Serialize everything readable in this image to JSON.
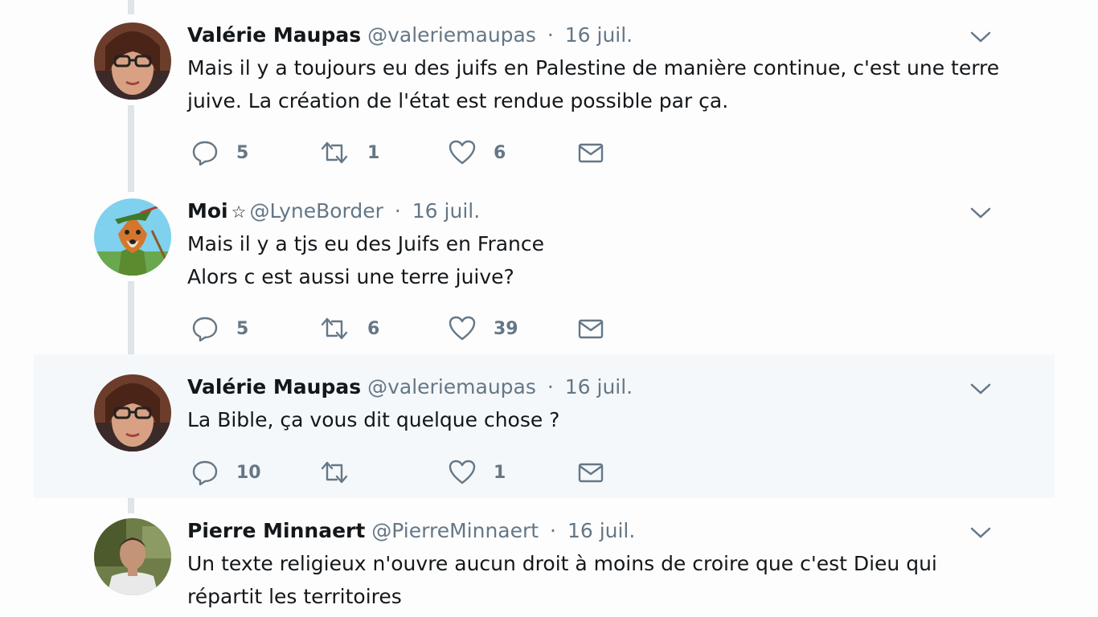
{
  "tweets": [
    {
      "name": "Valérie Maupas",
      "handle": "@valeriemaupas",
      "sep": "·",
      "date": "16 juil.",
      "lines": [
        "Mais il y a toujours eu des juifs en Palestine de manière continue, c'est une terre",
        "juive. La création de l'état est rendue possible par ça."
      ],
      "replies": "5",
      "retweets": "1",
      "likes": "6",
      "avatar": "woman-with-glasses-avatar"
    },
    {
      "name": "Moi",
      "badge": "☆",
      "handle": "@LyneBorder",
      "sep": "·",
      "date": "16 juil.",
      "lines": [
        "Mais il y a tjs eu des Juifs en France",
        "Alors c est aussi une terre juive?"
      ],
      "replies": "5",
      "retweets": "6",
      "likes": "39",
      "avatar": "cartoon-fox-archer-avatar"
    },
    {
      "name": "Valérie Maupas",
      "handle": "@valeriemaupas",
      "sep": "·",
      "date": "16 juil.",
      "lines": [
        "La Bible, ça vous dit quelque chose ?"
      ],
      "replies": "10",
      "retweets": "",
      "likes": "1",
      "avatar": "woman-with-glasses-avatar",
      "highlighted": true
    },
    {
      "name": "Pierre Minnaert",
      "handle": "@PierreMinnaert",
      "sep": "·",
      "date": "16 juil.",
      "lines": [
        "Un texte religieux n'ouvre aucun droit à moins de croire que c'est Dieu qui",
        "répartit les territoires"
      ],
      "avatar": "man-outdoors-avatar"
    }
  ],
  "colors": {
    "text": "#14171a",
    "secondary": "#657786",
    "icon": "#657786",
    "thread_line": "#dfe4e8",
    "highlight_bg": "#f5f8fa"
  }
}
